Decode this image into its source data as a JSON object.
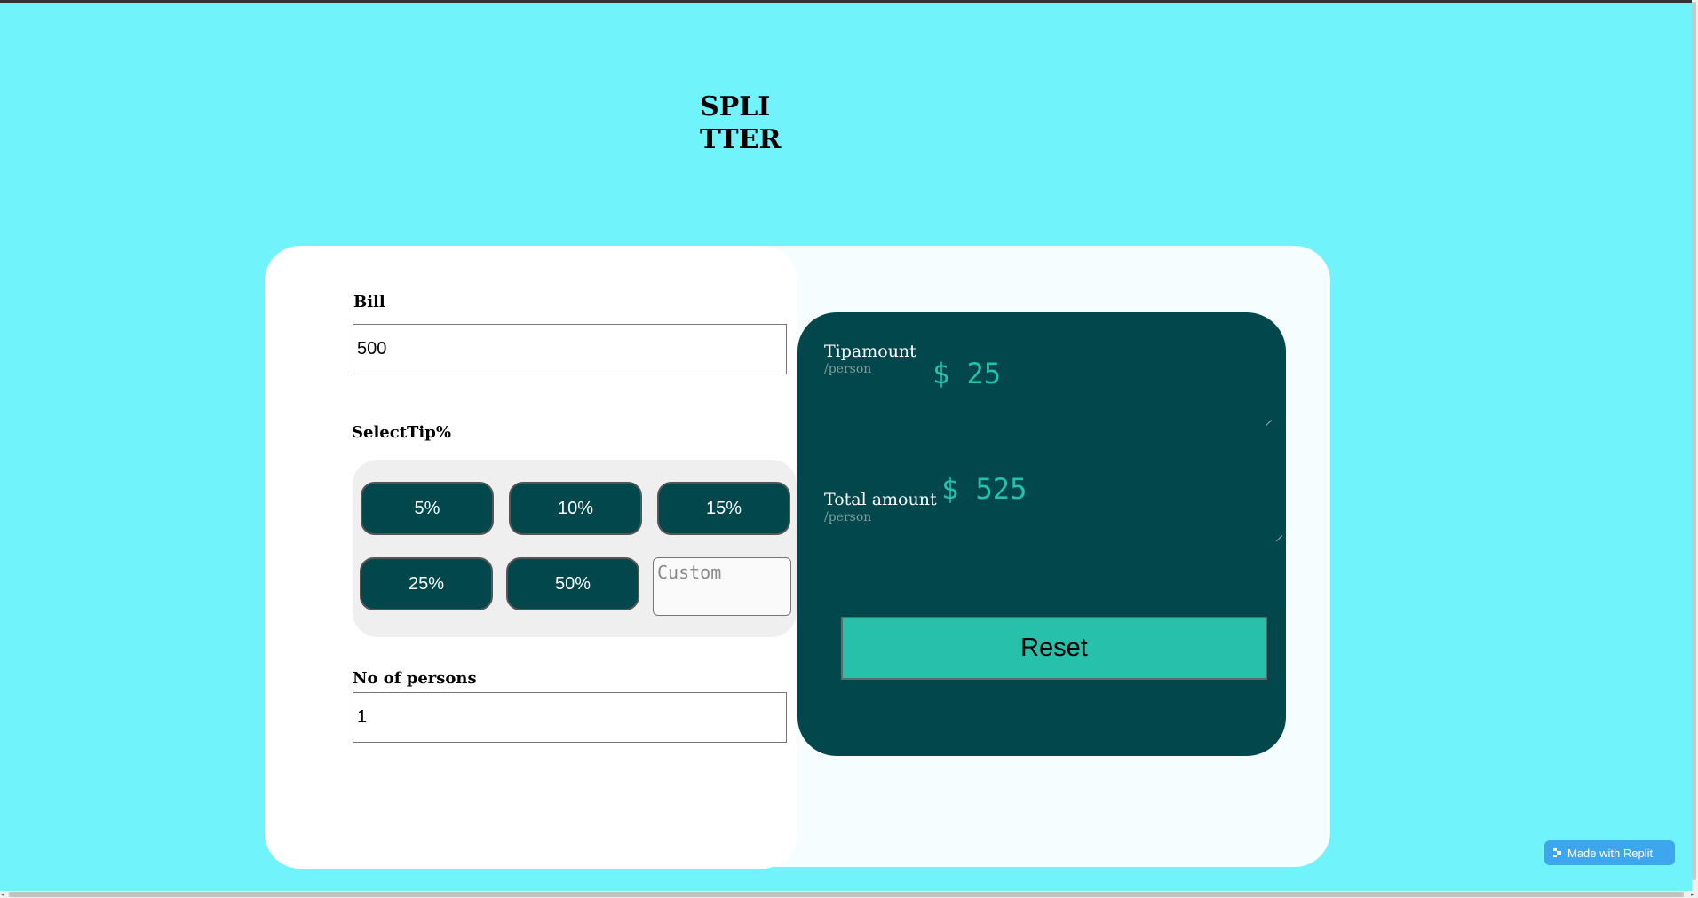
{
  "app": {
    "title": "SPLITTER"
  },
  "bill": {
    "label": "Bill",
    "value": "500"
  },
  "tip": {
    "label": "SelectTip%",
    "options": [
      "5%",
      "10%",
      "15%",
      "25%",
      "50%"
    ],
    "custom_placeholder": "Custom"
  },
  "persons": {
    "label": "No of persons",
    "value": "1"
  },
  "result": {
    "tip_label": "Tipamount",
    "tip_sub": "/person",
    "tip_value": "$ 25",
    "total_label": "Total amount",
    "total_sub": "/person",
    "total_value": "$ 525",
    "reset_label": "Reset"
  },
  "badge": {
    "label": "Made with Replit"
  },
  "colors": {
    "background": "#71f3fb",
    "dark_teal": "#01474b",
    "accent": "#26c0ab",
    "replit_badge": "#3da6ec"
  }
}
